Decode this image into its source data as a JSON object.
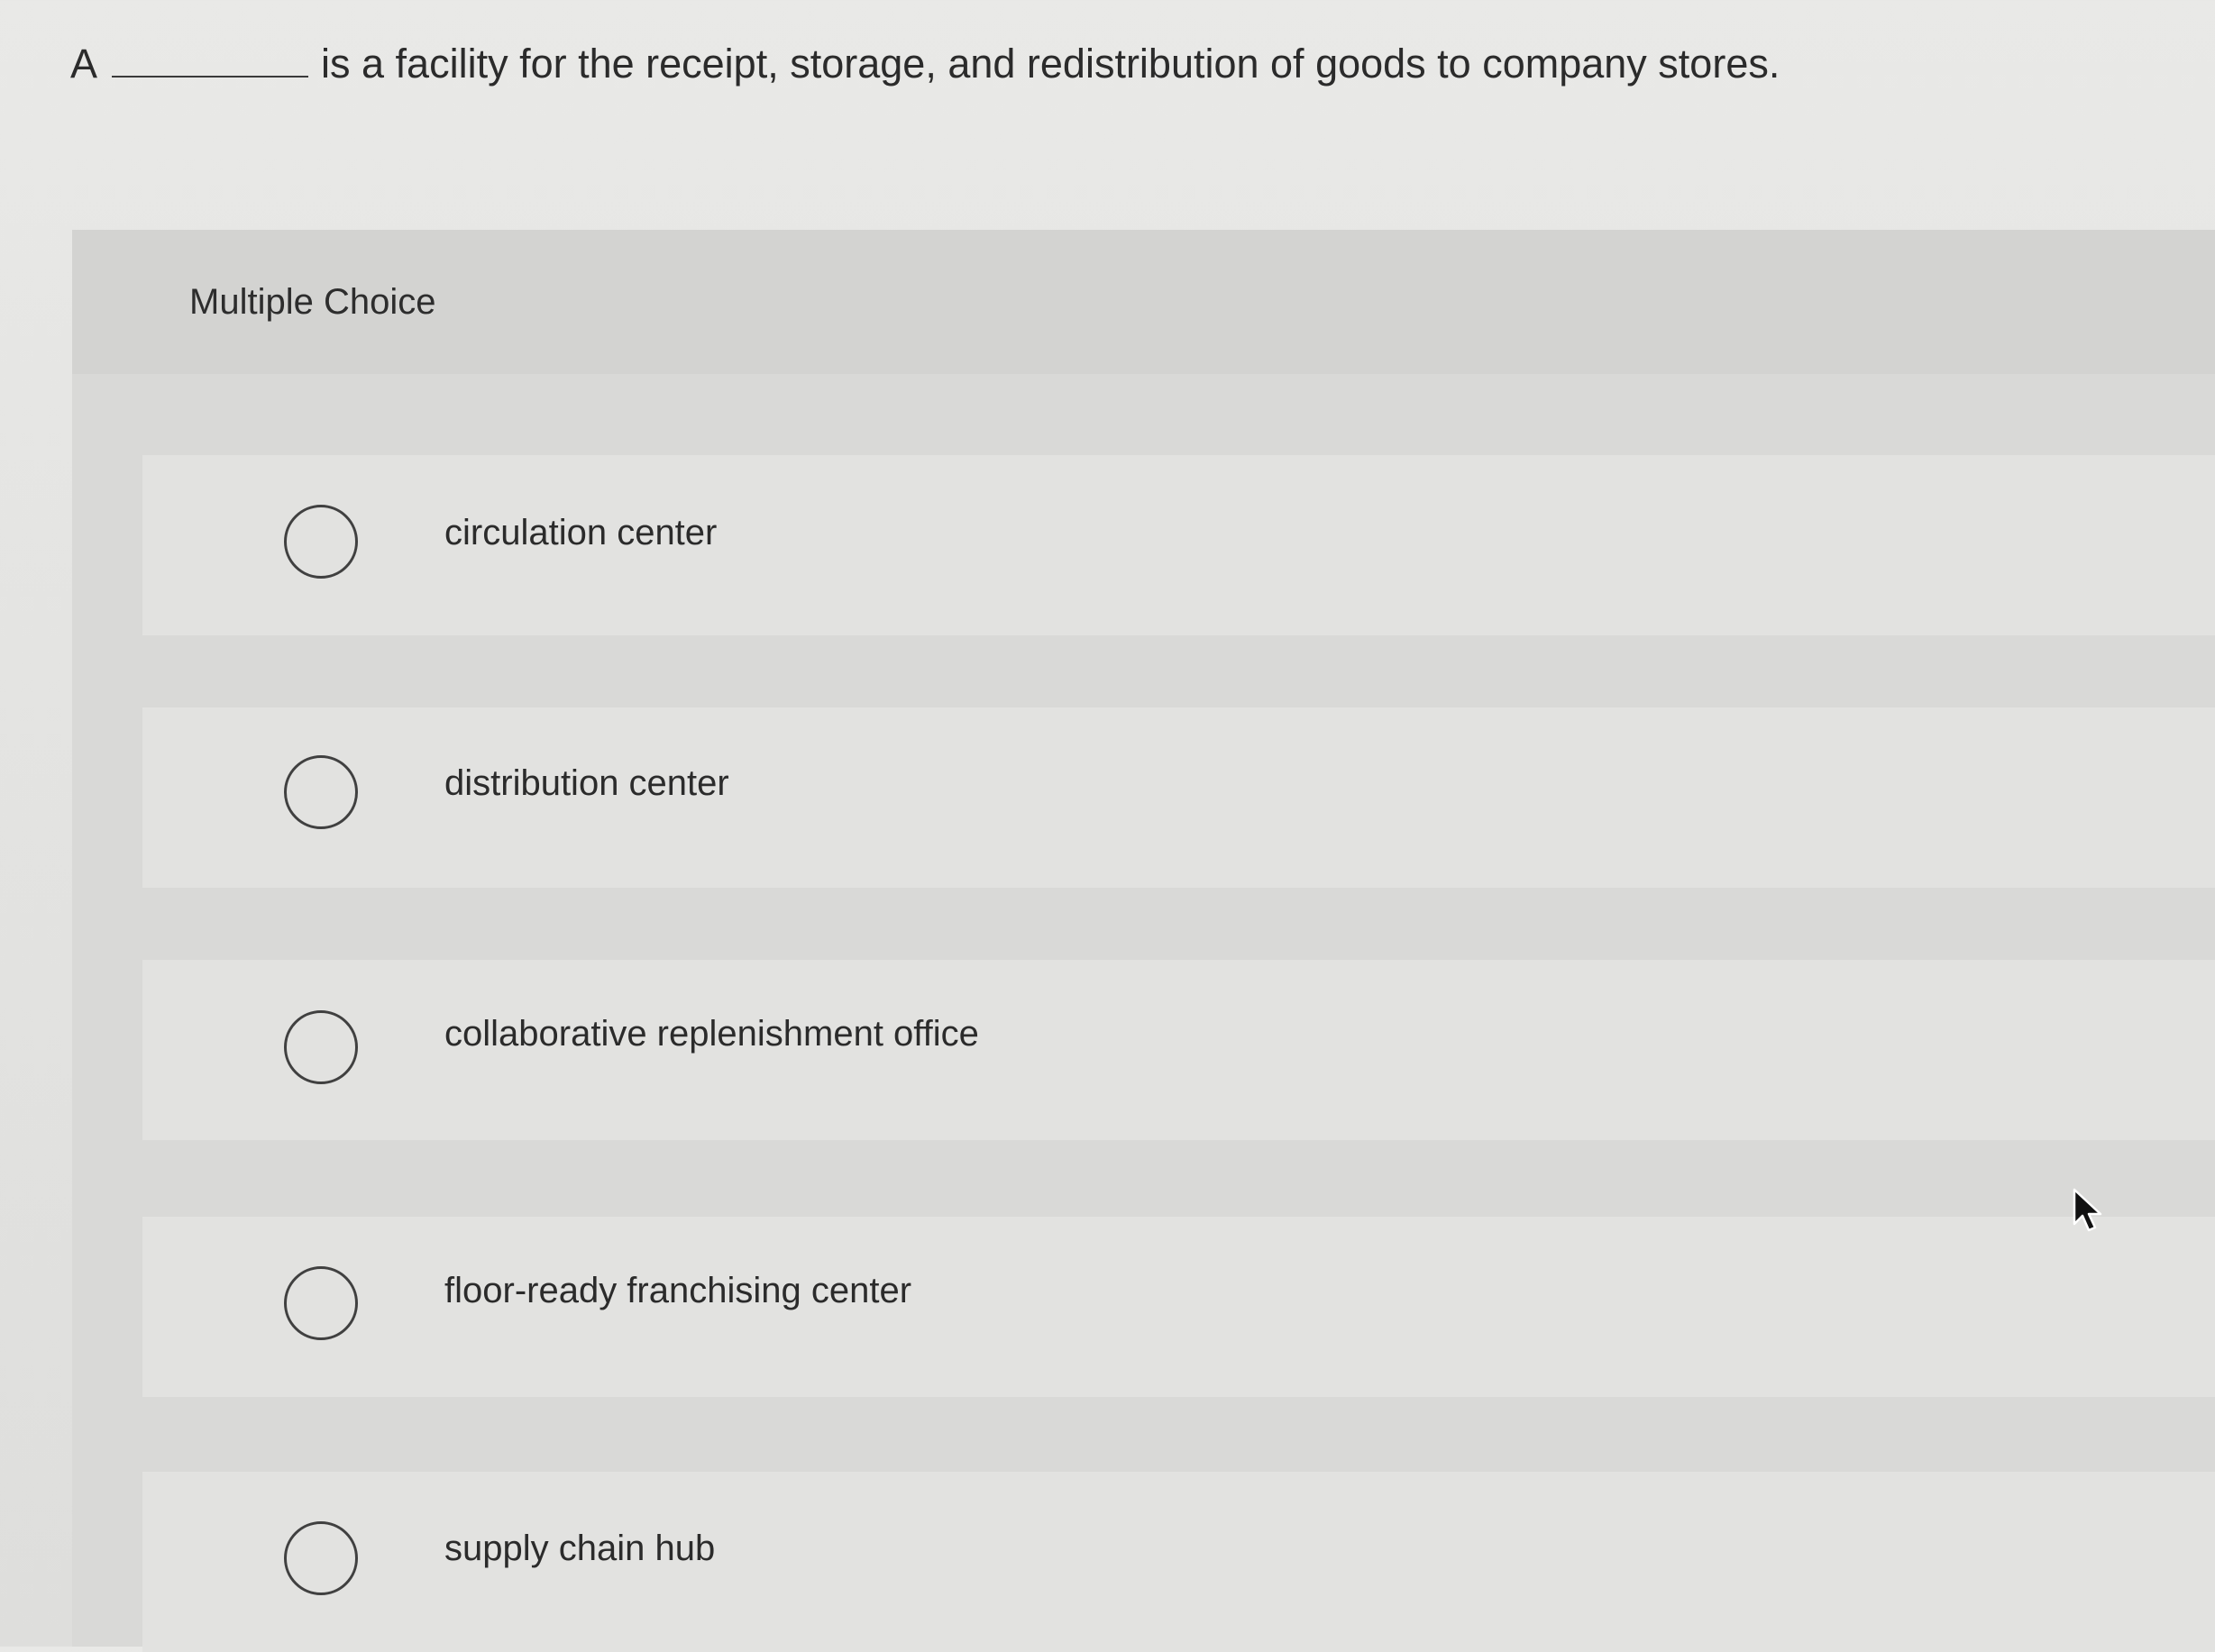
{
  "question": {
    "prefix": "A",
    "text": "is a facility for the receipt, storage, and redistribution of goods to company stores."
  },
  "panel": {
    "title": "Multiple Choice"
  },
  "options": [
    {
      "label": "circulation center",
      "selected": false
    },
    {
      "label": "distribution center",
      "selected": false
    },
    {
      "label": "collaborative replenishment office",
      "selected": false
    },
    {
      "label": "floor-ready franchising center",
      "selected": false
    },
    {
      "label": "supply chain hub",
      "selected": false
    }
  ],
  "icons": {
    "cursor": "mouse-pointer-icon"
  },
  "colors": {
    "text": "#2b2b2b",
    "radio_border": "#404040"
  }
}
